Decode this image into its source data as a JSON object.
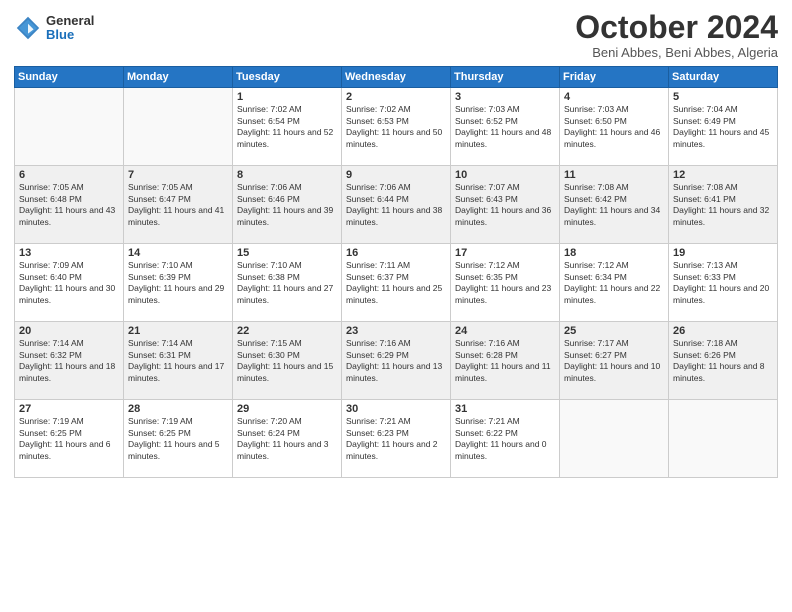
{
  "header": {
    "logo_general": "General",
    "logo_blue": "Blue",
    "month_title": "October 2024",
    "subtitle": "Beni Abbes, Beni Abbes, Algeria"
  },
  "days_of_week": [
    "Sunday",
    "Monday",
    "Tuesday",
    "Wednesday",
    "Thursday",
    "Friday",
    "Saturday"
  ],
  "weeks": [
    [
      {
        "num": "",
        "sunrise": "",
        "sunset": "",
        "daylight": "",
        "empty": true
      },
      {
        "num": "",
        "sunrise": "",
        "sunset": "",
        "daylight": "",
        "empty": true
      },
      {
        "num": "1",
        "sunrise": "Sunrise: 7:02 AM",
        "sunset": "Sunset: 6:54 PM",
        "daylight": "Daylight: 11 hours and 52 minutes."
      },
      {
        "num": "2",
        "sunrise": "Sunrise: 7:02 AM",
        "sunset": "Sunset: 6:53 PM",
        "daylight": "Daylight: 11 hours and 50 minutes."
      },
      {
        "num": "3",
        "sunrise": "Sunrise: 7:03 AM",
        "sunset": "Sunset: 6:52 PM",
        "daylight": "Daylight: 11 hours and 48 minutes."
      },
      {
        "num": "4",
        "sunrise": "Sunrise: 7:03 AM",
        "sunset": "Sunset: 6:50 PM",
        "daylight": "Daylight: 11 hours and 46 minutes."
      },
      {
        "num": "5",
        "sunrise": "Sunrise: 7:04 AM",
        "sunset": "Sunset: 6:49 PM",
        "daylight": "Daylight: 11 hours and 45 minutes."
      }
    ],
    [
      {
        "num": "6",
        "sunrise": "Sunrise: 7:05 AM",
        "sunset": "Sunset: 6:48 PM",
        "daylight": "Daylight: 11 hours and 43 minutes."
      },
      {
        "num": "7",
        "sunrise": "Sunrise: 7:05 AM",
        "sunset": "Sunset: 6:47 PM",
        "daylight": "Daylight: 11 hours and 41 minutes."
      },
      {
        "num": "8",
        "sunrise": "Sunrise: 7:06 AM",
        "sunset": "Sunset: 6:46 PM",
        "daylight": "Daylight: 11 hours and 39 minutes."
      },
      {
        "num": "9",
        "sunrise": "Sunrise: 7:06 AM",
        "sunset": "Sunset: 6:44 PM",
        "daylight": "Daylight: 11 hours and 38 minutes."
      },
      {
        "num": "10",
        "sunrise": "Sunrise: 7:07 AM",
        "sunset": "Sunset: 6:43 PM",
        "daylight": "Daylight: 11 hours and 36 minutes."
      },
      {
        "num": "11",
        "sunrise": "Sunrise: 7:08 AM",
        "sunset": "Sunset: 6:42 PM",
        "daylight": "Daylight: 11 hours and 34 minutes."
      },
      {
        "num": "12",
        "sunrise": "Sunrise: 7:08 AM",
        "sunset": "Sunset: 6:41 PM",
        "daylight": "Daylight: 11 hours and 32 minutes."
      }
    ],
    [
      {
        "num": "13",
        "sunrise": "Sunrise: 7:09 AM",
        "sunset": "Sunset: 6:40 PM",
        "daylight": "Daylight: 11 hours and 30 minutes."
      },
      {
        "num": "14",
        "sunrise": "Sunrise: 7:10 AM",
        "sunset": "Sunset: 6:39 PM",
        "daylight": "Daylight: 11 hours and 29 minutes."
      },
      {
        "num": "15",
        "sunrise": "Sunrise: 7:10 AM",
        "sunset": "Sunset: 6:38 PM",
        "daylight": "Daylight: 11 hours and 27 minutes."
      },
      {
        "num": "16",
        "sunrise": "Sunrise: 7:11 AM",
        "sunset": "Sunset: 6:37 PM",
        "daylight": "Daylight: 11 hours and 25 minutes."
      },
      {
        "num": "17",
        "sunrise": "Sunrise: 7:12 AM",
        "sunset": "Sunset: 6:35 PM",
        "daylight": "Daylight: 11 hours and 23 minutes."
      },
      {
        "num": "18",
        "sunrise": "Sunrise: 7:12 AM",
        "sunset": "Sunset: 6:34 PM",
        "daylight": "Daylight: 11 hours and 22 minutes."
      },
      {
        "num": "19",
        "sunrise": "Sunrise: 7:13 AM",
        "sunset": "Sunset: 6:33 PM",
        "daylight": "Daylight: 11 hours and 20 minutes."
      }
    ],
    [
      {
        "num": "20",
        "sunrise": "Sunrise: 7:14 AM",
        "sunset": "Sunset: 6:32 PM",
        "daylight": "Daylight: 11 hours and 18 minutes."
      },
      {
        "num": "21",
        "sunrise": "Sunrise: 7:14 AM",
        "sunset": "Sunset: 6:31 PM",
        "daylight": "Daylight: 11 hours and 17 minutes."
      },
      {
        "num": "22",
        "sunrise": "Sunrise: 7:15 AM",
        "sunset": "Sunset: 6:30 PM",
        "daylight": "Daylight: 11 hours and 15 minutes."
      },
      {
        "num": "23",
        "sunrise": "Sunrise: 7:16 AM",
        "sunset": "Sunset: 6:29 PM",
        "daylight": "Daylight: 11 hours and 13 minutes."
      },
      {
        "num": "24",
        "sunrise": "Sunrise: 7:16 AM",
        "sunset": "Sunset: 6:28 PM",
        "daylight": "Daylight: 11 hours and 11 minutes."
      },
      {
        "num": "25",
        "sunrise": "Sunrise: 7:17 AM",
        "sunset": "Sunset: 6:27 PM",
        "daylight": "Daylight: 11 hours and 10 minutes."
      },
      {
        "num": "26",
        "sunrise": "Sunrise: 7:18 AM",
        "sunset": "Sunset: 6:26 PM",
        "daylight": "Daylight: 11 hours and 8 minutes."
      }
    ],
    [
      {
        "num": "27",
        "sunrise": "Sunrise: 7:19 AM",
        "sunset": "Sunset: 6:25 PM",
        "daylight": "Daylight: 11 hours and 6 minutes."
      },
      {
        "num": "28",
        "sunrise": "Sunrise: 7:19 AM",
        "sunset": "Sunset: 6:25 PM",
        "daylight": "Daylight: 11 hours and 5 minutes."
      },
      {
        "num": "29",
        "sunrise": "Sunrise: 7:20 AM",
        "sunset": "Sunset: 6:24 PM",
        "daylight": "Daylight: 11 hours and 3 minutes."
      },
      {
        "num": "30",
        "sunrise": "Sunrise: 7:21 AM",
        "sunset": "Sunset: 6:23 PM",
        "daylight": "Daylight: 11 hours and 2 minutes."
      },
      {
        "num": "31",
        "sunrise": "Sunrise: 7:21 AM",
        "sunset": "Sunset: 6:22 PM",
        "daylight": "Daylight: 11 hours and 0 minutes."
      },
      {
        "num": "",
        "sunrise": "",
        "sunset": "",
        "daylight": "",
        "empty": true
      },
      {
        "num": "",
        "sunrise": "",
        "sunset": "",
        "daylight": "",
        "empty": true
      }
    ]
  ]
}
